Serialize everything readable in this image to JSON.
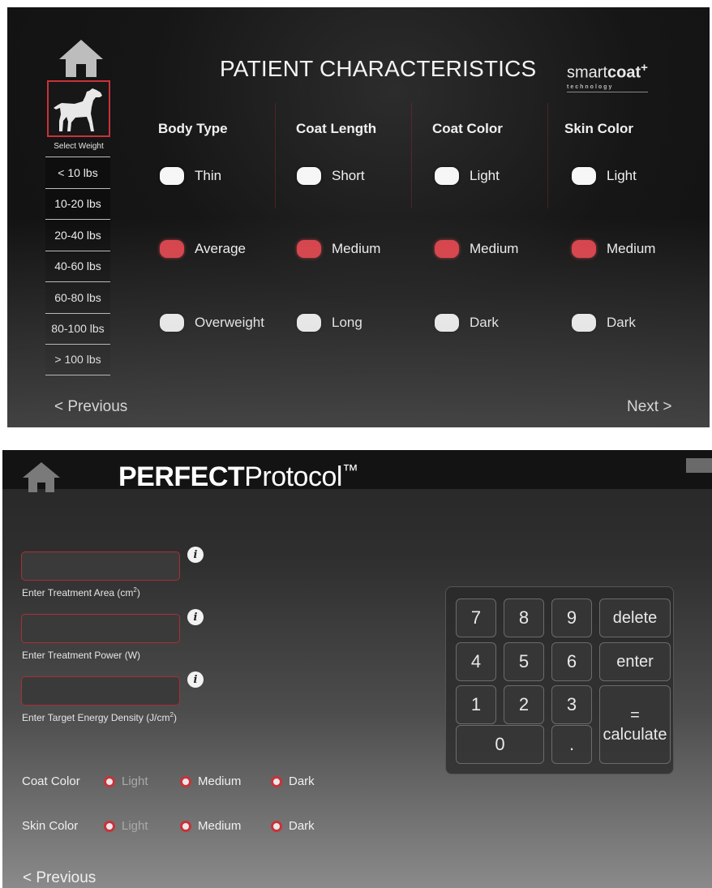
{
  "screen1": {
    "title": "PATIENT CHARACTERISTICS",
    "logo": {
      "brand_light": "smart",
      "brand_bold": "coat",
      "brand_plus": "+",
      "tagline": "technology"
    },
    "select_weight_label": "Select Weight",
    "weights": [
      "< 10 lbs",
      "10-20 lbs",
      "20-40 lbs",
      "40-60 lbs",
      "60-80 lbs",
      "80-100 lbs",
      "> 100 lbs"
    ],
    "columns": [
      {
        "header": "Body Type",
        "options": [
          "Thin",
          "Average",
          "Overweight"
        ],
        "selected": 1
      },
      {
        "header": "Coat Length",
        "options": [
          "Short",
          "Medium",
          "Long"
        ],
        "selected": 1
      },
      {
        "header": "Coat Color",
        "options": [
          "Light",
          "Medium",
          "Dark"
        ],
        "selected": 1
      },
      {
        "header": "Skin Color",
        "options": [
          "Light",
          "Medium",
          "Dark"
        ],
        "selected": 1
      }
    ],
    "prev_label": "< Previous",
    "next_label": "Next >",
    "colors": {
      "accent": "#d9424a"
    },
    "icons": {
      "home": "home-icon",
      "dog": "dog-icon"
    }
  },
  "screen2": {
    "title_bold": "PERFECT",
    "title_light": "Protocol",
    "title_tm": "™",
    "fields": [
      {
        "label_main": "Enter Treatment Area (cm",
        "label_sup": "2",
        "label_end": ")",
        "value": ""
      },
      {
        "label_main": "Enter Treatment Power (W)",
        "label_sup": "",
        "label_end": "",
        "value": ""
      },
      {
        "label_main": "Enter Target Energy Density (J/cm",
        "label_sup": "2",
        "label_end": ")",
        "value": ""
      }
    ],
    "info_glyph": "i",
    "coat_color": {
      "label": "Coat Color",
      "options": [
        "Light",
        "Medium",
        "Dark"
      ]
    },
    "skin_color": {
      "label": "Skin Color",
      "options": [
        "Light",
        "Medium",
        "Dark"
      ]
    },
    "keypad": {
      "digits": [
        "7",
        "8",
        "9",
        "4",
        "5",
        "6",
        "1",
        "2",
        "3",
        "0",
        "."
      ],
      "delete": "delete",
      "enter": "enter",
      "calc_eq": "=",
      "calc_word": "calculate"
    },
    "prev_label": "< Previous",
    "colors": {
      "accent": "#c9323a"
    },
    "icons": {
      "home": "home-icon",
      "info": "info-icon"
    }
  }
}
